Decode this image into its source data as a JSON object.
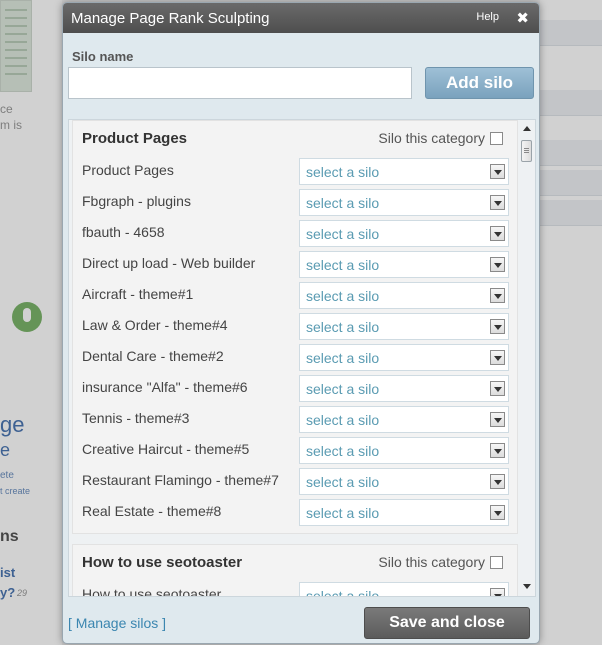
{
  "background": {
    "left_text": [
      "ce",
      "m is"
    ],
    "heading": [
      "ge",
      "e"
    ],
    "small_links": [
      "ete",
      "t create"
    ],
    "section": "ns",
    "link": [
      "ist",
      "y?"
    ],
    "count": "29"
  },
  "dialog": {
    "title": "Manage Page Rank Sculpting",
    "help_label": "Help",
    "close_glyph": "✖"
  },
  "silo_form": {
    "label": "Silo name",
    "input_value": "",
    "add_label": "Add silo"
  },
  "panels": [
    {
      "title": "Product Pages",
      "silo_category_label": "Silo this category",
      "rows": [
        {
          "name": "Product Pages",
          "value": "select a silo"
        },
        {
          "name": "Fbgraph - plugins",
          "value": "select a silo"
        },
        {
          "name": "fbauth - 4658",
          "value": "select a silo"
        },
        {
          "name": "Direct up load - Web builder",
          "value": "select a silo"
        },
        {
          "name": "Aircraft - theme#1",
          "value": "select a silo"
        },
        {
          "name": "Law & Order - theme#4",
          "value": "select a silo"
        },
        {
          "name": "Dental Care - theme#2",
          "value": "select a silo"
        },
        {
          "name": "insurance \"Alfa\" - theme#6",
          "value": "select a silo"
        },
        {
          "name": "Tennis - theme#3",
          "value": "select a silo"
        },
        {
          "name": "Creative Haircut - theme#5",
          "value": "select a silo"
        },
        {
          "name": "Restaurant Flamingo - theme#7",
          "value": "select a silo"
        },
        {
          "name": "Real Estate - theme#8",
          "value": "select a silo"
        }
      ]
    },
    {
      "title": "How to use seotoaster",
      "silo_category_label": "Silo this category",
      "rows": [
        {
          "name": "How to use seotoaster",
          "value": "select a silo"
        }
      ]
    }
  ],
  "footer": {
    "manage_silos": "[ Manage silos ]",
    "save_close": "Save and close"
  },
  "colors": {
    "dialog_bg": "#dfe9ee",
    "titlebar": "#555555",
    "accent": "#7aa2bd",
    "link": "#3b86b0",
    "select_text": "#5a9bb2"
  }
}
